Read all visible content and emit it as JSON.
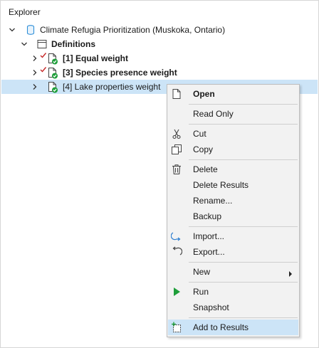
{
  "panel": {
    "title": "Explorer"
  },
  "tree": {
    "root": {
      "label": "Climate Refugia Prioritization (Muskoka, Ontario)",
      "icon": "database-icon"
    },
    "definitions": {
      "label": "Definitions",
      "icon": "table-icon"
    },
    "items": [
      {
        "label": "[1] Equal weight",
        "bold": true,
        "edited": true
      },
      {
        "label": "[3] Species presence weight",
        "bold": true,
        "edited": true
      },
      {
        "label": "[4] Lake properties weight",
        "bold": false,
        "edited": false,
        "selected": true
      }
    ]
  },
  "context_menu": {
    "items": [
      {
        "label": "Open",
        "bold": true,
        "icon": "document-icon"
      },
      {
        "label": "Read Only"
      },
      {
        "label": "Cut",
        "icon": "scissors-icon"
      },
      {
        "label": "Copy",
        "icon": "copy-icon"
      },
      {
        "label": "Delete",
        "icon": "trash-icon"
      },
      {
        "label": "Delete Results"
      },
      {
        "label": "Rename..."
      },
      {
        "label": "Backup"
      },
      {
        "label": "Import...",
        "icon": "import-icon"
      },
      {
        "label": "Export...",
        "icon": "export-icon"
      },
      {
        "label": "New",
        "submenu": true
      },
      {
        "label": "Run",
        "icon": "play-icon"
      },
      {
        "label": "Snapshot"
      },
      {
        "label": "Add to Results",
        "icon": "add-to-results-icon",
        "hover": true
      }
    ]
  },
  "colors": {
    "accent": "#cce4f7",
    "check": "#1e9e3a",
    "edit_mark": "#c62828",
    "db": "#2f8fd8"
  }
}
